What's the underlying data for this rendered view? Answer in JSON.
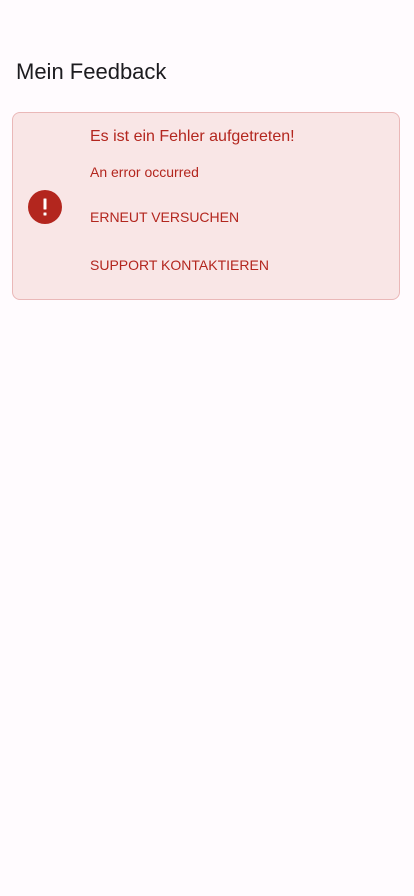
{
  "header": {
    "title": "Mein Feedback"
  },
  "error_card": {
    "icon": "error-icon",
    "title": "Es ist ein Fehler aufgetreten!",
    "message": "An error occurred",
    "retry_label": "ERNEUT VERSUCHEN",
    "support_label": "SUPPORT KONTAKTIEREN"
  },
  "colors": {
    "error": "#b3261e",
    "card_background": "#f9e6e6",
    "card_border": "#eab8b8",
    "page_background": "#fffbfe",
    "title_text": "#1c1b1f"
  }
}
